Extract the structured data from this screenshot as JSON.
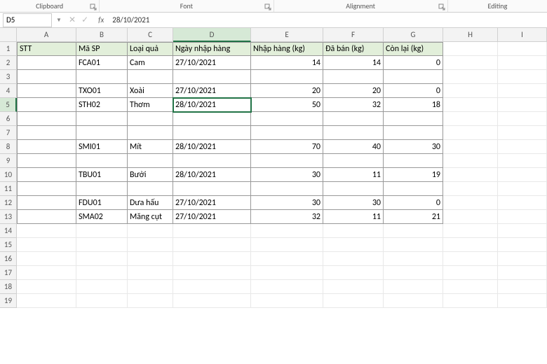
{
  "ribbon": {
    "groups": [
      "Clipboard",
      "Font",
      "Alignment",
      "Editing"
    ]
  },
  "nameBox": "D5",
  "formulaValue": "28/10/2021",
  "columns": [
    "A",
    "B",
    "C",
    "D",
    "E",
    "F",
    "G",
    "H",
    "I"
  ],
  "activeCol": 3,
  "activeRow": 5,
  "headers": {
    "A": "STT",
    "B": "Mã SP",
    "C": "Loại quả",
    "D": "Ngày nhập hàng",
    "E": "Nhập hàng (kg)",
    "F": "Đã bán (kg)",
    "G": "Còn lại (kg)"
  },
  "rows": [
    {
      "r": 2,
      "B": "FCA01",
      "C": "Cam",
      "D": "27/10/2021",
      "E": "14",
      "F": "14",
      "G": "0"
    },
    {
      "r": 3
    },
    {
      "r": 4,
      "B": "TXO01",
      "C": "Xoài",
      "D": "27/10/2021",
      "E": "20",
      "F": "20",
      "G": "0"
    },
    {
      "r": 5,
      "B": "STH02",
      "C": "Thơm",
      "D": "28/10/2021",
      "E": "50",
      "F": "32",
      "G": "18"
    },
    {
      "r": 6
    },
    {
      "r": 7
    },
    {
      "r": 8,
      "B": "SMI01",
      "C": "Mít",
      "D": "28/10/2021",
      "E": "70",
      "F": "40",
      "G": "30"
    },
    {
      "r": 9
    },
    {
      "r": 10,
      "B": "TBU01",
      "C": "Bưởi",
      "D": "28/10/2021",
      "E": "30",
      "F": "11",
      "G": "19"
    },
    {
      "r": 11
    },
    {
      "r": 12,
      "B": "FDU01",
      "C": "Dưa hấu",
      "D": "27/10/2021",
      "E": "30",
      "F": "30",
      "G": "0"
    },
    {
      "r": 13,
      "B": "SMA02",
      "C": "Măng cụt",
      "D": "27/10/2021",
      "E": "32",
      "F": "11",
      "G": "21"
    }
  ],
  "totalRows": 19,
  "dataLastRow": 13
}
